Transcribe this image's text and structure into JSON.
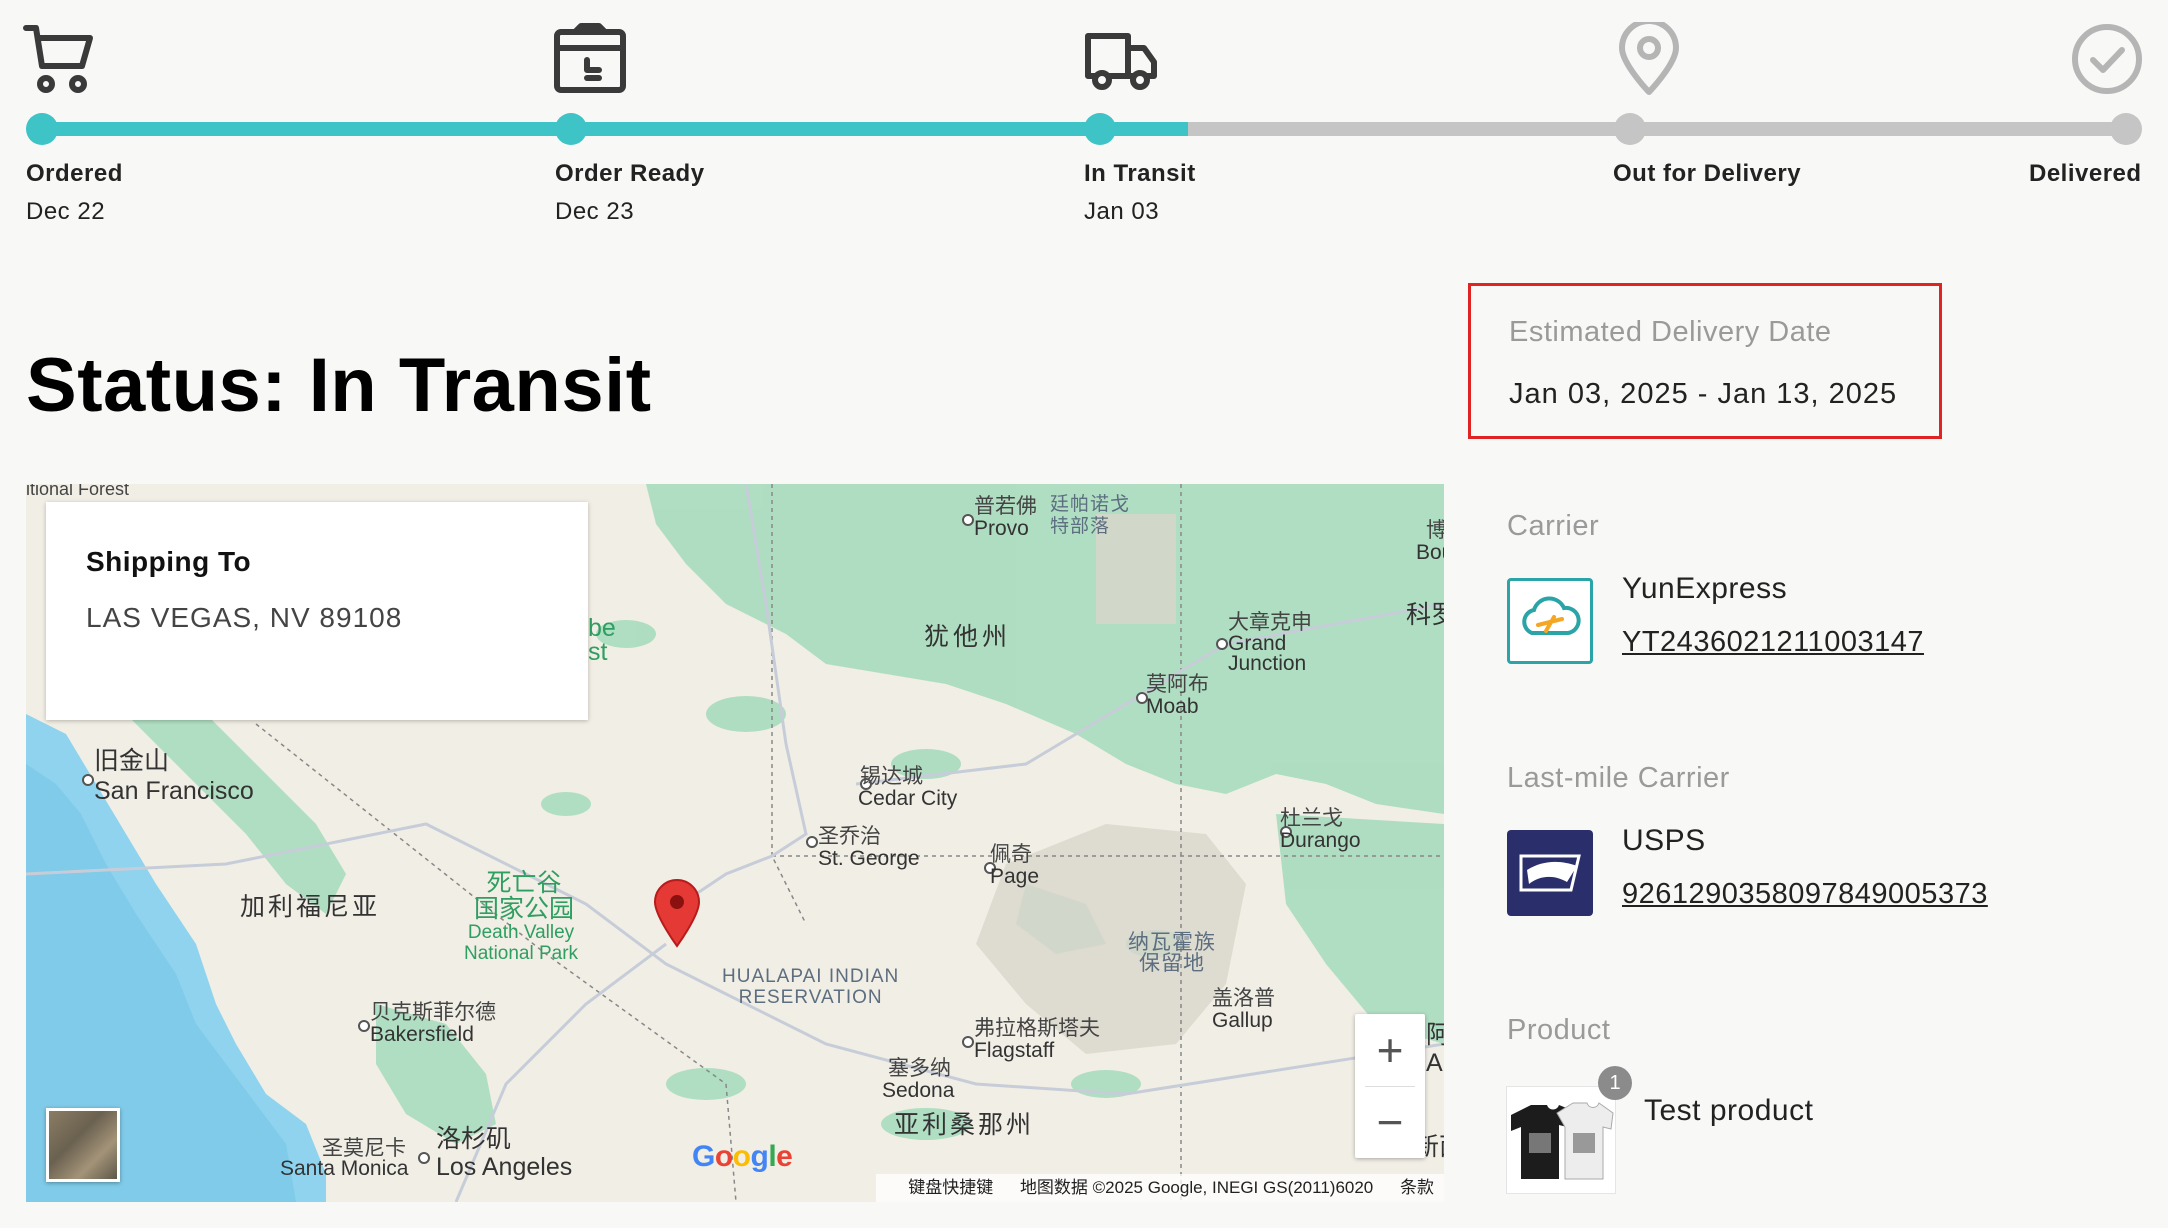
{
  "tracker": {
    "steps": [
      {
        "label": "Ordered",
        "date": "Dec 22",
        "icon": "cart-icon",
        "state": "complete"
      },
      {
        "label": "Order Ready",
        "date": "Dec 23",
        "icon": "package-icon",
        "state": "complete"
      },
      {
        "label": "In Transit",
        "date": "Jan 03",
        "icon": "truck-icon",
        "state": "current"
      },
      {
        "label": "Out for Delivery",
        "date": "",
        "icon": "map-pin-icon",
        "state": "pending"
      },
      {
        "label": "Delivered",
        "date": "",
        "icon": "check-circle-icon",
        "state": "pending"
      }
    ],
    "colors": {
      "active": "#3ec3c6",
      "inactive": "#c5c5c5",
      "icon_active": "#3a3a3a",
      "icon_inactive": "#b5b5b5"
    }
  },
  "status": {
    "title": "Status: In Transit"
  },
  "map": {
    "shipping_card": {
      "title": "Shipping To",
      "address": "LAS VEGAS, NV 89108"
    },
    "zoom": {
      "in": "+",
      "out": "−"
    },
    "logo": "Google",
    "attribution": {
      "shortcuts": "键盘快捷键",
      "data": "地图数据 ©2025 Google, INEGI GS(2011)6020",
      "terms": "条款"
    },
    "labels": {
      "forest": "itional Forest",
      "provo_cn": "普若佛",
      "provo": "Provo",
      "ute_cn": "廷帕诺戈\n特部落",
      "bou_cn": "博",
      "bou": "Bou",
      "utah": "犹他州",
      "grand_junction_cn": "大章克申",
      "grand_junction": "Grand\nJunction",
      "kesi": "科罗",
      "moab_cn": "莫阿布",
      "moab": "Moab",
      "be": "be\nst",
      "sf_cn": "旧金山",
      "sf": "San Francisco",
      "cedar_cn": "锡达城",
      "cedar": "Cedar City",
      "durango_cn": "杜兰戈",
      "durango": "Durango",
      "stgeorge_cn": "圣乔治",
      "stgeorge": "St. George",
      "page_cn": "佩奇",
      "page": "Page",
      "deathvalley_cn": "死亡谷\n国家公园",
      "deathvalley": "Death Valley\nNational Park",
      "california": "加利福尼亚",
      "navajo": "纳瓦霍族\n保留地",
      "hualapai": "HUALAPAI INDIAN\nRESERVATION",
      "gallup_cn": "盖洛普",
      "gallup": "Gallup",
      "bakersfield_cn": "贝克斯菲尔德",
      "bakersfield": "Bakersfield",
      "flagstaff_cn": "弗拉格斯塔夫",
      "flagstaff": "Flagstaff",
      "sedona_cn": "塞多纳",
      "sedona": "Sedona",
      "santamonica_cn": "圣莫尼卡",
      "santamonica": "Santa Monica",
      "la_cn": "洛杉矶",
      "la": "Los Angeles",
      "arizona": "亚利桑那州",
      "edge1": "阿",
      "edge2": "Alu",
      "edge3": "新西"
    }
  },
  "estimated": {
    "label": "Estimated Delivery Date",
    "value": "Jan 03, 2025 - Jan 13, 2025",
    "highlight_color": "#e02424"
  },
  "carrier": {
    "label": "Carrier",
    "name": "YunExpress",
    "tracking": "YT2436021211003147"
  },
  "last_mile": {
    "label": "Last-mile Carrier",
    "name": "USPS",
    "tracking": "9261290358097849005373"
  },
  "product": {
    "label": "Product",
    "name": "Test product",
    "quantity": "1"
  }
}
